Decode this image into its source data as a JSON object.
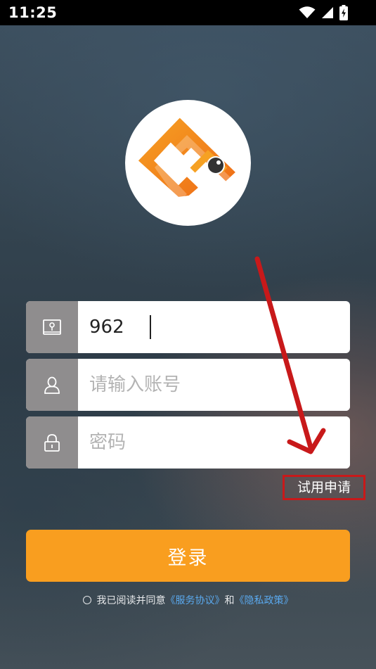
{
  "status_bar": {
    "time": "11:25",
    "icons": [
      "wifi-icon",
      "signal-icon",
      "battery-charging-icon"
    ]
  },
  "logo": {
    "icon": "app-logo"
  },
  "form": {
    "company_code": {
      "value": "962",
      "icon": "id-card-icon"
    },
    "account": {
      "placeholder": "请输入账号",
      "icon": "user-icon"
    },
    "password": {
      "placeholder": "密码",
      "icon": "lock-icon"
    }
  },
  "trial_link": "试用申请",
  "login_button": "登录",
  "agreement": {
    "prefix": "我已阅读并同意",
    "service_link": "《服务协议》",
    "conjunction": "和",
    "privacy_link": "《隐私政策》"
  },
  "colors": {
    "accent": "#f99e1f",
    "icon_box": "#8f8d8e",
    "link": "#5aa9ee",
    "annotation": "#c8191a"
  }
}
